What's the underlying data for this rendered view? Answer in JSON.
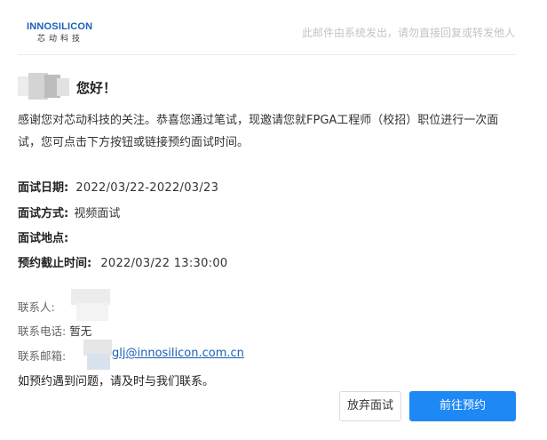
{
  "header": {
    "logo_text": "INNOSILICON",
    "logo_subtext": "芯动科技",
    "notice": "此邮件由系统发出，请勿直接回复或转发他人"
  },
  "greeting": "您好！",
  "intro": "感谢您对芯动科技的关注。恭喜您通过笔试，现邀请您就FPGA工程师（校招）职位进行一次面试，您可点击下方按钮或链接预约面试时间。",
  "interview": {
    "date_label": "面试日期:",
    "date_value": "2022/03/22-2022/03/23",
    "mode_label": "面试方式:",
    "mode_value": "视频面试",
    "location_label": "面试地点:",
    "location_value": "",
    "deadline_label": "预约截止时间:",
    "deadline_value": "2022/03/22 13:30:00"
  },
  "contact": {
    "person_label": "联系人:",
    "phone_label": "联系电话:",
    "phone_value": "暂无",
    "email_label": "联系邮箱:",
    "email_value": "glj@innosilicon.com.cn"
  },
  "help_text": "如预约遇到问题，请及时与我们联系。",
  "buttons": {
    "decline": "放弃面试",
    "book": "前往预约"
  },
  "colors": {
    "primary": "#1e88f5",
    "brand": "#1a5fb4"
  }
}
